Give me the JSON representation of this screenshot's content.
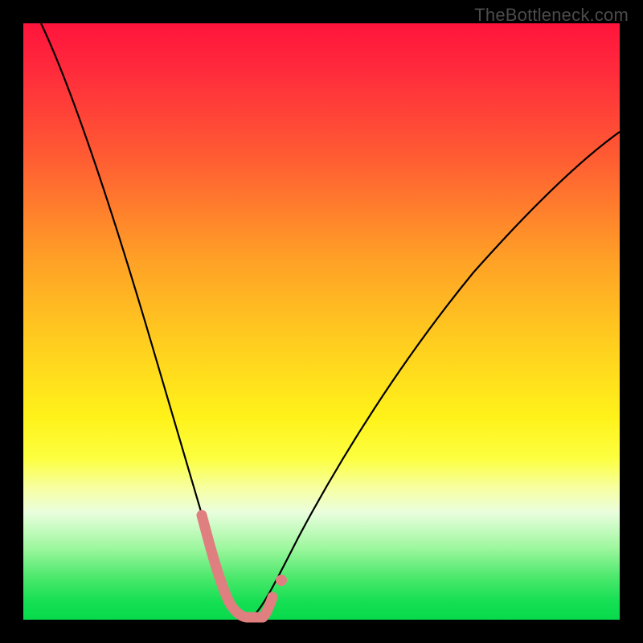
{
  "watermark": "TheBottleneck.com",
  "chart_data": {
    "type": "line",
    "title": "",
    "xlabel": "",
    "ylabel": "",
    "xlim": [
      0,
      100
    ],
    "ylim": [
      0,
      100
    ],
    "grid": false,
    "series": [
      {
        "name": "bottleneck-curve",
        "color": "#000000",
        "stroke_width": 2,
        "x": [
          3,
          5,
          8,
          11,
          14,
          17,
          20,
          23,
          26,
          28,
          30,
          31.5,
          33,
          34.5,
          36,
          37.5,
          39,
          41,
          44,
          48,
          53,
          58,
          64,
          70,
          76,
          82,
          88,
          94,
          100
        ],
        "values": [
          100,
          92,
          82,
          73,
          64,
          55,
          46,
          37,
          28,
          21,
          14,
          9,
          5,
          2.5,
          1.2,
          0.7,
          1.4,
          3.5,
          8,
          15,
          24,
          33,
          42,
          50,
          57,
          63,
          68,
          72,
          75
        ]
      },
      {
        "name": "highlight-valley",
        "color": "#e07a7a",
        "stroke_width": 11,
        "x": [
          28,
          30,
          31.5,
          33,
          34.5,
          36,
          37.5,
          39
        ],
        "values": [
          21,
          14,
          9,
          5,
          2.5,
          1.2,
          0.7,
          1.4
        ],
        "note": "approximate valley highlight band rendered as thick pink overlay"
      }
    ],
    "markers": [
      {
        "x": 40.5,
        "y": 3.0,
        "r": 6,
        "color": "#e07a7a",
        "name": "highlight-end-dot"
      }
    ],
    "gradient_stops": [
      {
        "pos": 0.0,
        "color": "#ff143c"
      },
      {
        "pos": 0.55,
        "color": "#ffd21e"
      },
      {
        "pos": 0.78,
        "color": "#f7ffa3"
      },
      {
        "pos": 1.0,
        "color": "#08da4c"
      }
    ]
  }
}
